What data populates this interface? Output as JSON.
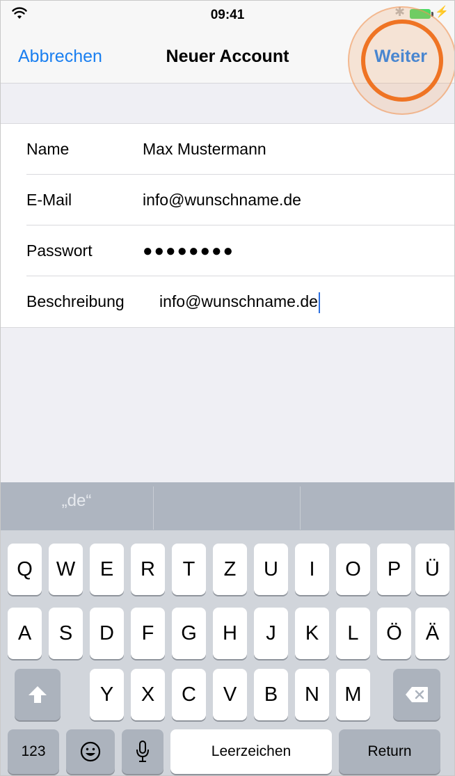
{
  "status_bar": {
    "time": "09:41",
    "wifi_icon": "wifi-icon",
    "bluetooth_icon": "bluetooth-icon",
    "battery_icon": "battery-charging-icon"
  },
  "nav": {
    "cancel_label": "Abbrechen",
    "title": "Neuer Account",
    "next_label": "Weiter"
  },
  "form": {
    "rows": [
      {
        "label": "Name",
        "value": "Max Mustermann"
      },
      {
        "label": "E-Mail",
        "value": "info@wunschname.de"
      },
      {
        "label": "Passwort",
        "value": "●●●●●●●●"
      },
      {
        "label": "Beschreibung",
        "value": "info@wunschname.de"
      }
    ]
  },
  "keyboard": {
    "suggestions": [
      "„de“",
      "",
      ""
    ],
    "rows": [
      [
        "Q",
        "W",
        "E",
        "R",
        "T",
        "Z",
        "U",
        "I",
        "O",
        "P",
        "Ü"
      ],
      [
        "A",
        "S",
        "D",
        "F",
        "G",
        "H",
        "J",
        "K",
        "L",
        "Ö",
        "Ä"
      ],
      [
        "Y",
        "X",
        "C",
        "V",
        "B",
        "N",
        "M"
      ]
    ],
    "numbers_label": "123",
    "space_label": "Leerzeichen",
    "return_label": "Return",
    "shift_icon": "shift-icon",
    "delete_icon": "delete-icon",
    "emoji_icon": "emoji-icon",
    "mic_icon": "microphone-icon"
  },
  "colors": {
    "accent": "#1a7ff0",
    "highlight": "#ef7424"
  }
}
